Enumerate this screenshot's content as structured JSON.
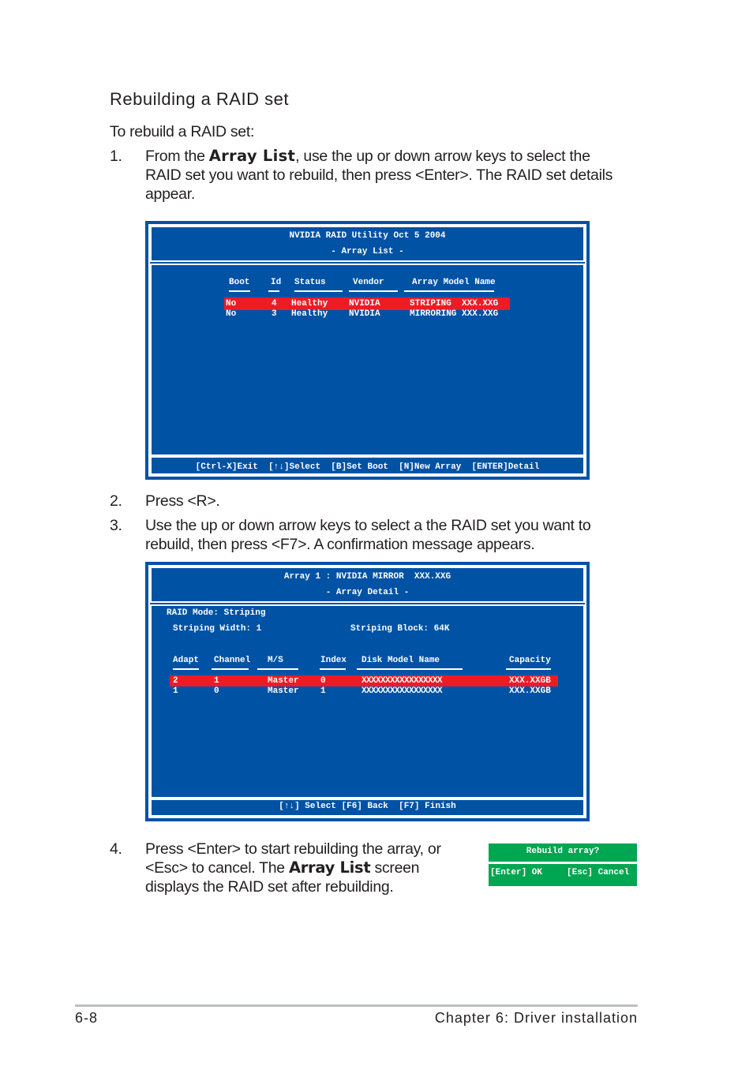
{
  "heading": "Rebuilding a RAID set",
  "intro": "To rebuild a RAID set:",
  "steps": [
    {
      "num": "1.",
      "line1_pre": "From the ",
      "line1_bold": "Array List",
      "line1_post": ", use the up or down arrow keys to select the",
      "line2": "RAID set you want to rebuild, then press <Enter>. The RAID set details",
      "line3": "appear."
    },
    {
      "num": "2.",
      "line1": "Press <R>."
    },
    {
      "num": "3.",
      "line1": "Use the up or down arrow keys to select a the RAID set you want to",
      "line2": "rebuild, then press <F7>. A confirmation message appears."
    },
    {
      "num": "4.",
      "line1": "Press <Enter> to start rebuilding the array, or",
      "line2_pre": "<Esc> to cancel. The ",
      "line2_bold": "Array List",
      "line2_post": " screen",
      "line3": "displays the RAID set after rebuilding."
    }
  ],
  "screen1": {
    "title": "NVIDIA RAID Utility  Oct 5 2004",
    "subtitle": "- Array List -",
    "headers": [
      "Boot",
      "Id",
      "Status",
      "Vendor",
      "Array Model Name"
    ],
    "rows": [
      {
        "boot": "No",
        "id": "4",
        "status": "Healthy",
        "vendor": "NVIDIA",
        "model": "STRIPING  XXX.XXG",
        "selected": true
      },
      {
        "boot": "No",
        "id": "3",
        "status": "Healthy",
        "vendor": "NVIDIA",
        "model": "MIRRORING XXX.XXG",
        "selected": false
      }
    ],
    "footer": "[Ctrl-X]Exit  [↑↓]Select  [B]Set Boot  [N]New Array  [ENTER]Detail"
  },
  "screen2": {
    "title": "Array 1 : NVIDIA MIRROR  XXX.XXG",
    "subtitle": "- Array Detail -",
    "raid_mode": "RAID Mode: Striping",
    "striping_width": "Striping Width: 1",
    "striping_block": "Striping Block: 64K",
    "headers": [
      "Adapt",
      "Channel",
      "M/S",
      "Index",
      "Disk Model Name",
      "Capacity"
    ],
    "rows": [
      {
        "adapt": "2",
        "channel": "1",
        "ms": "Master",
        "index": "0",
        "model": "XXXXXXXXXXXXXXXXX",
        "capacity": "XXX.XXGB",
        "selected": true
      },
      {
        "adapt": "1",
        "channel": "0",
        "ms": "Master",
        "index": "1",
        "model": "XXXXXXXXXXXXXXXXX",
        "capacity": "XXX.XXGB",
        "selected": false
      }
    ],
    "footer": "[↑↓] Select [F6] Back  [F7] Finish"
  },
  "dialog": {
    "title": "Rebuild array?",
    "ok": "[Enter] OK",
    "cancel": "[Esc] Cancel"
  },
  "footer": {
    "page": "6-8",
    "chapter": "Chapter 6: Driver installation"
  },
  "colors": {
    "screen_bg": "#0052a5",
    "highlight": "#ed1c24",
    "dialog": "#00a651"
  }
}
